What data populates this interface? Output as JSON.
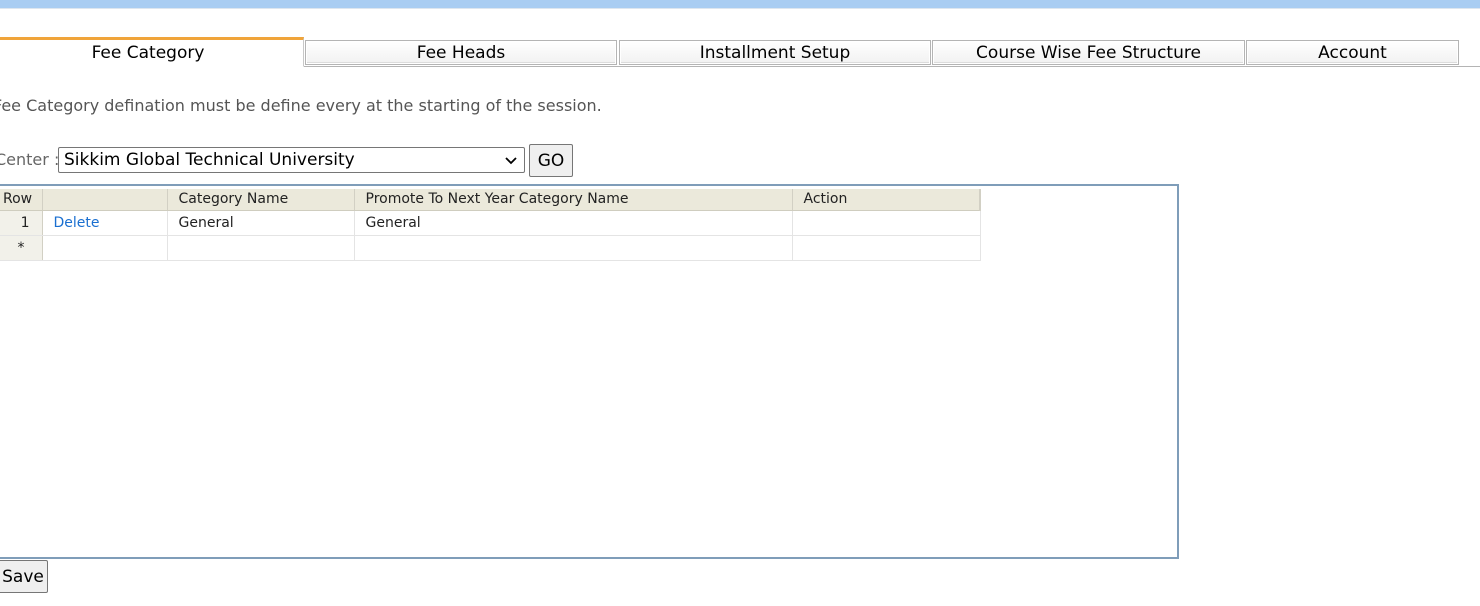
{
  "tabs": [
    {
      "label": "Fee Category",
      "active": true
    },
    {
      "label": "Fee Heads",
      "active": false
    },
    {
      "label": "Installment Setup",
      "active": false
    },
    {
      "label": "Course Wise Fee Structure",
      "active": false
    },
    {
      "label": "Account",
      "active": false
    }
  ],
  "info_text": "Fee Category defination must be define every at the starting of the session.",
  "center": {
    "label": "Center :",
    "selected": "Sikkim Global Technical University",
    "go_label": "GO"
  },
  "grid": {
    "columns": [
      "Row",
      "",
      "Category Name",
      "Promote To Next Year Category Name",
      "Action"
    ],
    "rows": [
      {
        "row": "1",
        "link": "Delete",
        "category": "General",
        "promote": "General",
        "action": ""
      },
      {
        "row": "*",
        "link": "",
        "category": "",
        "promote": "",
        "action": ""
      }
    ]
  },
  "save_label": "Save",
  "colors": {
    "accent_tab": "#f0a43a",
    "grid_header": "#ebe9db",
    "link": "#1a6fd0",
    "frame": "#7f9db9"
  }
}
